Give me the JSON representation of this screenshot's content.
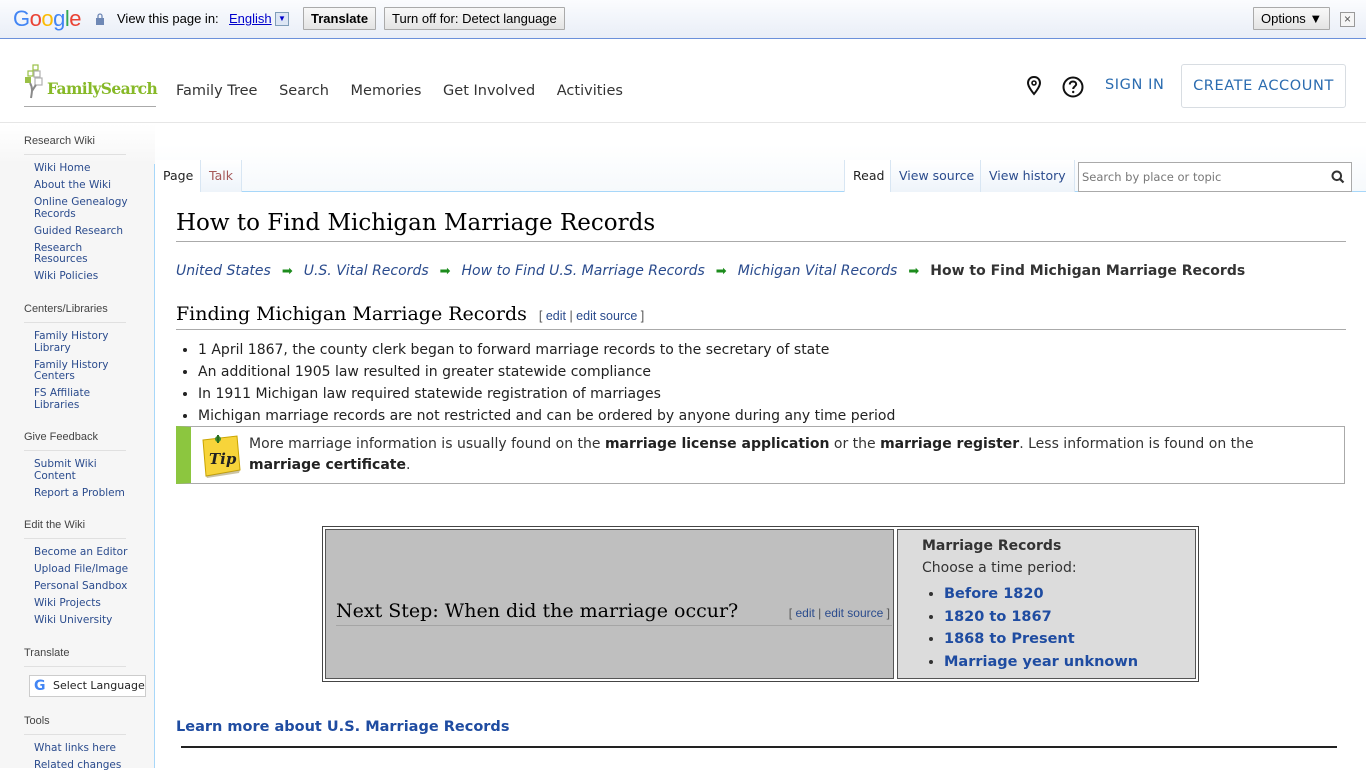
{
  "translate_bar": {
    "brand": [
      "G",
      "o",
      "o",
      "g",
      "l",
      "e"
    ],
    "view_in_label": "View this page in:",
    "language": "English",
    "translate_button": "Translate",
    "turn_off_button": "Turn off for: Detect language",
    "options_button": "Options ▼",
    "close_icon": "×"
  },
  "header": {
    "logo_text": "FamilySearch",
    "nav": [
      "Family Tree",
      "Search",
      "Memories",
      "Get Involved",
      "Activities"
    ],
    "sign_in": "SIGN IN",
    "create_account": "CREATE ACCOUNT"
  },
  "sidebar": {
    "sections": [
      {
        "title": "Research Wiki",
        "items": [
          "Wiki Home",
          "About the Wiki",
          "Online Genealogy Records",
          "Guided Research",
          "Research Resources",
          "Wiki Policies"
        ]
      },
      {
        "title": "Centers/Libraries",
        "items": [
          "Family History Library",
          "Family History Centers",
          "FS Affiliate Libraries"
        ]
      },
      {
        "title": "Give Feedback",
        "items": [
          "Submit Wiki Content",
          "Report a Problem"
        ]
      },
      {
        "title": "Edit the Wiki",
        "items": [
          "Become an Editor",
          "Upload File/Image",
          "Personal Sandbox",
          "Wiki Projects",
          "Wiki University"
        ]
      },
      {
        "title": "Translate",
        "select_language": "Select Language"
      },
      {
        "title": "Tools",
        "items": [
          "What links here",
          "Related changes"
        ]
      }
    ]
  },
  "tabs": {
    "page": "Page",
    "talk": "Talk",
    "read": "Read",
    "view_source": "View source",
    "view_history": "View history",
    "search_placeholder": "Search by place or topic"
  },
  "article": {
    "title": "How to Find Michigan Marriage Records",
    "breadcrumbs": [
      "United States",
      "U.S. Vital Records",
      "How to Find U.S. Marriage Records",
      "Michigan Vital Records"
    ],
    "breadcrumb_current": "How to Find Michigan Marriage Records",
    "section_title": "Finding Michigan Marriage Records",
    "edit": "edit",
    "edit_source": "edit source",
    "facts": [
      "1 April 1867, the county clerk began to forward marriage records to the secretary of state",
      "An additional 1905 law resulted in greater statewide compliance",
      "In 1911 Michigan law required statewide registration of marriages",
      "Michigan marriage records are not restricted and can be ordered by anyone during any time period"
    ],
    "tip": {
      "icon_label": "Tip",
      "t1": "More marriage information is usually found on the ",
      "b1": "marriage license application",
      "t2": " or the ",
      "b2": "marriage register",
      "t3": ". Less information is found on the ",
      "b3": "marriage certificate",
      "t4": "."
    },
    "next_step": {
      "heading": "Next Step: When did the marriage occur?",
      "box_title": "Marriage Records",
      "box_subtitle": "Choose a time period:",
      "periods": [
        "Before 1820",
        "1820 to 1867",
        "1868 to Present",
        "Marriage year unknown"
      ]
    },
    "learn_more": "Learn more about U.S. Marriage Records"
  }
}
